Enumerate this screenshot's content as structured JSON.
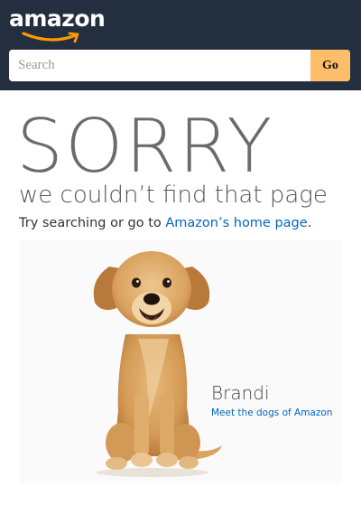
{
  "header": {
    "logo_text": "amazon",
    "search": {
      "placeholder": "Search",
      "value": "",
      "button_label": "Go"
    }
  },
  "error": {
    "headline": "SORRY",
    "subtitle": "we couldn’t find that page",
    "try_prefix": "Try searching or go to ",
    "home_link": "Amazon’s home page",
    "try_suffix": "."
  },
  "dog": {
    "name": "Brandi",
    "link": "Meet the dogs of Amazon"
  },
  "colors": {
    "header_bg": "#232f3e",
    "go_button": "#febd69",
    "smile": "#ff9900",
    "link": "#0066c0"
  }
}
